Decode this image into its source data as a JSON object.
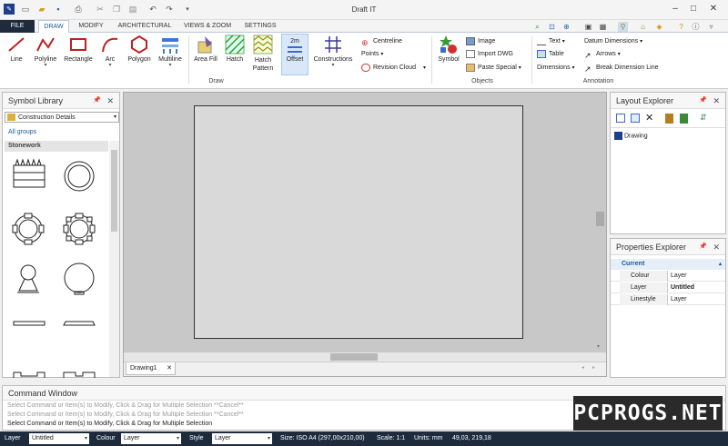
{
  "app": {
    "title": "Draft IT"
  },
  "tabs": [
    "FILE",
    "DRAW",
    "MODIFY",
    "ARCHITECTURAL",
    "VIEWS & ZOOM",
    "SETTINGS"
  ],
  "ribbon": {
    "draw_buttons": [
      "Line",
      "Polyline",
      "Rectangle",
      "Arc",
      "Polygon",
      "Multiline"
    ],
    "fill_buttons": [
      "Area Fill",
      "Hatch",
      "Hatch Pattern"
    ],
    "offset": "Offset",
    "offset_badge": "2m",
    "constructions": "Constructions",
    "centreline": "Centreline",
    "points": "Points",
    "revision_cloud": "Revision Cloud",
    "draw_group": "Draw",
    "symbol": "Symbol",
    "image": "Image",
    "import_dwg": "Import DWG",
    "paste_special": "Paste Special",
    "objects_group": "Objects",
    "text": "Text",
    "table": "Table",
    "dimensions": "Dimensions",
    "datum_dimensions": "Datum Dimensions",
    "arrows": "Arrows",
    "break_dimension_line": "Break Dimension Line",
    "annotation_group": "Annotation"
  },
  "symbol_library": {
    "title": "Symbol Library",
    "category": "Construction Details",
    "all_groups": "All groups",
    "group": "Stonework"
  },
  "canvas": {
    "doc_tab": "Drawing1"
  },
  "layout_explorer": {
    "title": "Layout Explorer",
    "item": "Drawing"
  },
  "properties": {
    "title": "Properties Explorer",
    "section": "Current",
    "rows": [
      {
        "name": "Colour",
        "value": "Layer"
      },
      {
        "name": "Layer",
        "value": "Untitled"
      },
      {
        "name": "Linestyle",
        "value": "Layer"
      }
    ]
  },
  "command": {
    "title": "Command Window",
    "lines": [
      "Select Command or Item(s) to Modify, Click & Drag for Multiple Selection  **Cancel**",
      "Select Command or Item(s) to Modify, Click & Drag for Multiple Selection  **Cancel**",
      "Select Command or Item(s) to Modify, Click & Drag for Multiple Selection"
    ]
  },
  "status": {
    "layer_label": "Layer",
    "layer_value": "Untitled",
    "colour_label": "Colour",
    "colour_value": "Layer",
    "style_label": "Style",
    "style_value": "Layer",
    "size": "Size: ISO A4 (297,00x210,00)",
    "scale": "Scale: 1:1",
    "units": "Units: mm",
    "coords": "49,03, 219,18"
  },
  "watermark": "PCPROGS.NET",
  "colors": {
    "accent": "#1a5a9a",
    "statusbar": "#1e2b3c",
    "file_tab": "#1e2b3c"
  }
}
